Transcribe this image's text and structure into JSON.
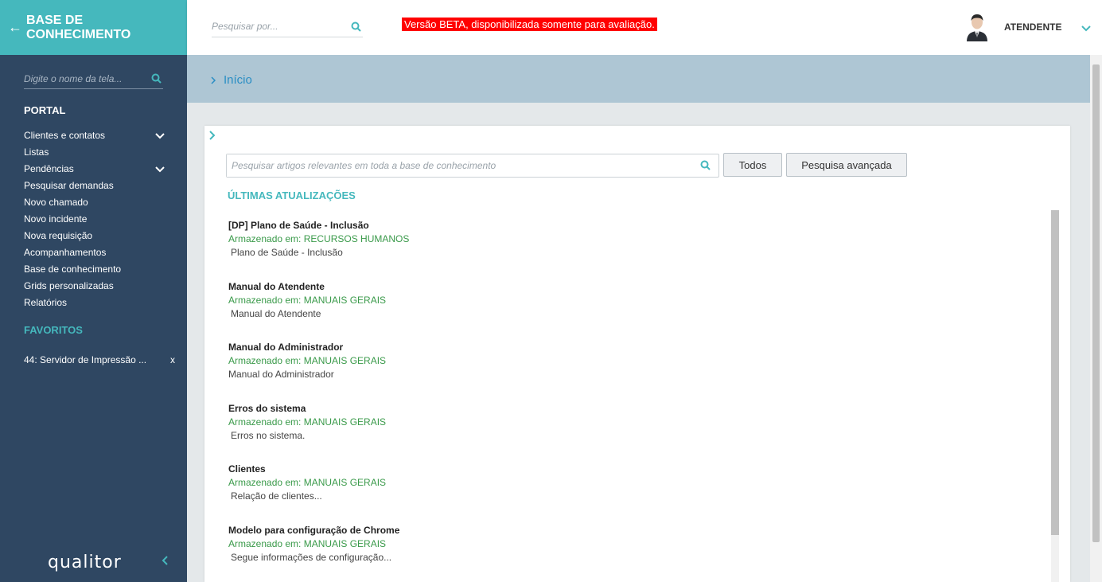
{
  "sidebar": {
    "brand": "BASE DE CONHECIMENTO",
    "search_placeholder": "Digite o nome da tela...",
    "portal_label": "PORTAL",
    "items": [
      {
        "label": "Clientes e contatos",
        "expandable": true
      },
      {
        "label": "Listas",
        "expandable": false
      },
      {
        "label": "Pendências",
        "expandable": true
      },
      {
        "label": "Pesquisar demandas",
        "expandable": false
      },
      {
        "label": "Novo chamado",
        "expandable": false
      },
      {
        "label": "Novo incidente",
        "expandable": false
      },
      {
        "label": "Nova requisição",
        "expandable": false
      },
      {
        "label": "Acompanhamentos",
        "expandable": false
      },
      {
        "label": "Base de conhecimento",
        "expandable": false
      },
      {
        "label": "Grids personalizadas",
        "expandable": false
      },
      {
        "label": "Relatórios",
        "expandable": false
      }
    ],
    "favorites_label": "FAVORITOS",
    "favorites": [
      {
        "label": "44: Servidor de Impressão ...",
        "remove": "x"
      }
    ],
    "logo": "qualitor"
  },
  "topbar": {
    "search_placeholder": "Pesquisar por...",
    "beta_notice": "Versão BETA, disponibilizada somente para avaliação.",
    "username": "ATENDENTE"
  },
  "breadcrumb": {
    "current": "Início"
  },
  "main": {
    "search_placeholder": "Pesquisar artigos relevantes em toda a base de conhecimento",
    "todos_label": "Todos",
    "advanced_label": "Pesquisa avançada",
    "updates_title": "ÚLTIMAS ATUALIZAÇÕES",
    "articles": [
      {
        "title": "[DP] Plano de Saúde - Inclusão",
        "stored": "Armazenado em: RECURSOS HUMANOS",
        "desc": "Plano de Saúde - Inclusão"
      },
      {
        "title": "Manual do Atendente",
        "stored": "Armazenado em: MANUAIS GERAIS",
        "desc": "Manual do Atendente"
      },
      {
        "title": "Manual do Administrador",
        "stored": "Armazenado em: MANUAIS GERAIS",
        "desc": "Manual do Administrador"
      },
      {
        "title": "Erros do sistema",
        "stored": "Armazenado em: MANUAIS GERAIS",
        "desc": "Erros no sistema."
      },
      {
        "title": "Clientes",
        "stored": "Armazenado em: MANUAIS GERAIS",
        "desc": "Relação de clientes..."
      },
      {
        "title": "Modelo para configuração de Chrome",
        "stored": "Armazenado em: MANUAIS GERAIS",
        "desc": "Segue informações de configuração..."
      }
    ]
  },
  "colors": {
    "accent": "#45b8bd",
    "sidebar_bg": "#2f4762",
    "beta_bg": "#ff0000",
    "stored_green": "#3a9a4a",
    "breadcrumb_bg": "#aec6d4"
  },
  "icons": [
    "back-arrow-icon",
    "search-icon",
    "chevron-down-icon",
    "chevron-right-icon",
    "chevron-left-icon",
    "user-avatar-icon"
  ]
}
